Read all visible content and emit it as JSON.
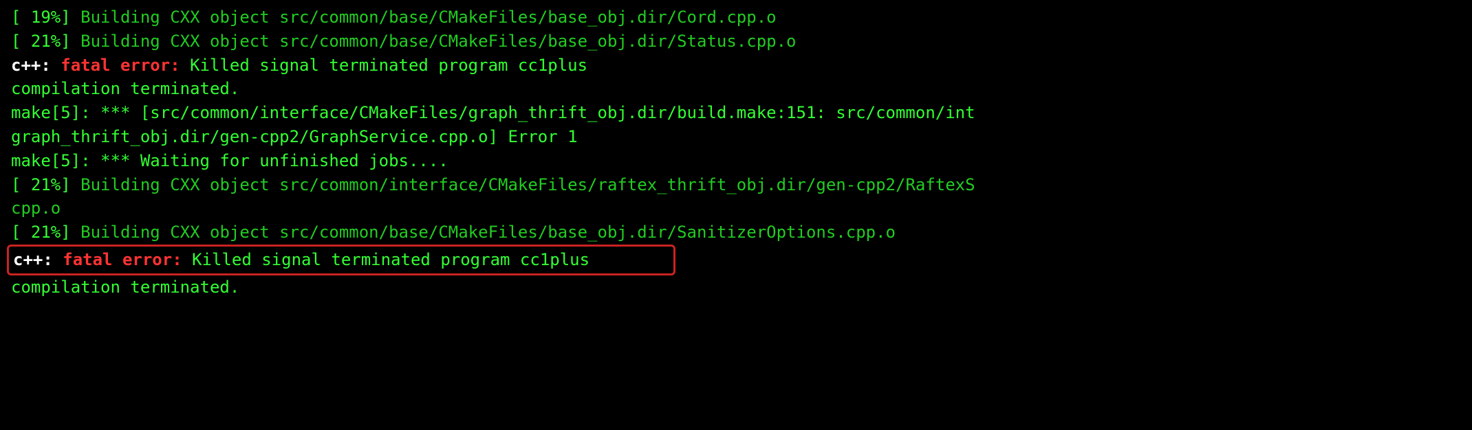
{
  "lines": {
    "l1": {
      "percent": "[ 19%]",
      "rest": " Building CXX object src/common/base/CMakeFiles/base_obj.dir/Cord.cpp.o"
    },
    "l2": {
      "percent": "[ 21%]",
      "rest": " Building CXX object src/common/base/CMakeFiles/base_obj.dir/Status.cpp.o"
    },
    "l3": {
      "cpp": "c++: ",
      "fatal": "fatal error: ",
      "msg": "Killed signal terminated program cc1plus"
    },
    "l4": "compilation terminated.",
    "l5": "make[5]: *** [src/common/interface/CMakeFiles/graph_thrift_obj.dir/build.make:151: src/common/int",
    "l6": "graph_thrift_obj.dir/gen-cpp2/GraphService.cpp.o] Error 1",
    "l7": "make[5]: *** Waiting for unfinished jobs....",
    "l8": {
      "percent": "[ 21%]",
      "rest": " Building CXX object src/common/interface/CMakeFiles/raftex_thrift_obj.dir/gen-cpp2/RaftexS"
    },
    "l9": "cpp.o",
    "l10": {
      "percent": "[ 21%]",
      "rest": " Building CXX object src/common/base/CMakeFiles/base_obj.dir/SanitizerOptions.cpp.o"
    },
    "l11": {
      "cpp": "c++: ",
      "fatal": "fatal error: ",
      "msg": "Killed signal terminated program cc1plus"
    },
    "l12": "compilation terminated."
  }
}
